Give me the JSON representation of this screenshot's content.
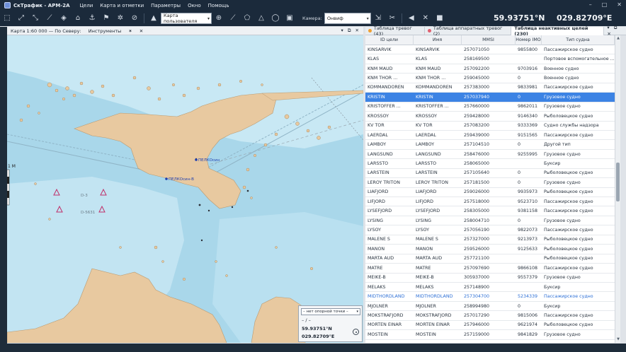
{
  "app": {
    "title": "СкТрафик - АРМ-2А",
    "menu": [
      "Цели",
      "Карта и отметки",
      "Параметры",
      "Окно",
      "Помощь"
    ]
  },
  "toolbar": {
    "map_combo": "Карта пользователя",
    "camera_label": "Камера:",
    "camera_combo": "Онвиф",
    "lat": "59.93751°N",
    "lon": "029.82709°E"
  },
  "left_panel": {
    "tab": "Карта 1:60 000 — По Северу:",
    "tab2": "Инструменты",
    "controls": "▾ ⧉ ✕"
  },
  "map": {
    "scale": "1 M",
    "labels": [
      "ПЕЛКОсин",
      "ПЕЛКОсин-В"
    ],
    "depths": [
      "D-3",
      "D-5631"
    ]
  },
  "coordbox": {
    "select": "– нет опорной точки –",
    "dash": "– / –",
    "lat": "59.93751°N",
    "lon": "029.82709°E"
  },
  "right_tabs": [
    {
      "label": "Таблица тревог (43)",
      "dot": "#f0a030",
      "active": false
    },
    {
      "label": "Таблица аппаратных тревог (2)",
      "dot": "#e06070",
      "active": false
    },
    {
      "label": "Таблица неактивных целей (230)",
      "dot": "",
      "active": true
    }
  ],
  "table": {
    "headers": [
      "ID цели",
      "Имя",
      "MMSI",
      "Номер IMO",
      "Тип судна"
    ],
    "rows": [
      {
        "id": "KINSARVIK",
        "name": "KINSARVIK",
        "mmsi": "257071050",
        "imo": "9855800",
        "type": "Пассажирское судно",
        "state": ""
      },
      {
        "id": "KLAS",
        "name": "KLAS",
        "mmsi": "258169500",
        "imo": "",
        "type": "Портовое вспомогательное ...",
        "state": ""
      },
      {
        "id": "KNM MAUD",
        "name": "KNM MAUD",
        "mmsi": "257092200",
        "imo": "9703916",
        "type": "Военное судно",
        "state": ""
      },
      {
        "id": "KNM THOR ...",
        "name": "KNM THOR ...",
        "mmsi": "259045000",
        "imo": "0",
        "type": "Военное судно",
        "state": ""
      },
      {
        "id": "KOMMANDOREN",
        "name": "KOMMANDOREN",
        "mmsi": "257383000",
        "imo": "9833981",
        "type": "Пассажирское судно",
        "state": ""
      },
      {
        "id": "KRISTIN",
        "name": "KRISTIN",
        "mmsi": "257037940",
        "imo": "0",
        "type": "Грузовое судно",
        "state": "selected"
      },
      {
        "id": "KRISTOFFER ...",
        "name": "KRISTOFFER ...",
        "mmsi": "257660000",
        "imo": "9862011",
        "type": "Грузовое судно",
        "state": ""
      },
      {
        "id": "KROSSOY",
        "name": "KROSSOY",
        "mmsi": "259428000",
        "imo": "9146340",
        "type": "Рыболовецкое судно",
        "state": ""
      },
      {
        "id": "KV TOR",
        "name": "KV TOR",
        "mmsi": "257083200",
        "imo": "9333369",
        "type": "Судно службы надзора",
        "state": ""
      },
      {
        "id": "LAERDAL",
        "name": "LAERDAL",
        "mmsi": "259439000",
        "imo": "9151565",
        "type": "Пассажирское судно",
        "state": ""
      },
      {
        "id": "LAMBOY",
        "name": "LAMBOY",
        "mmsi": "257104510",
        "imo": "0",
        "type": "Другой тип",
        "state": ""
      },
      {
        "id": "LANGSUND",
        "name": "LANGSUND",
        "mmsi": "258476000",
        "imo": "9255995",
        "type": "Грузовое судно",
        "state": ""
      },
      {
        "id": "LARSSTO",
        "name": "LARSSTO",
        "mmsi": "258065000",
        "imo": "",
        "type": "Буксир",
        "state": ""
      },
      {
        "id": "LARSTEIN",
        "name": "LARSTEIN",
        "mmsi": "257105640",
        "imo": "0",
        "type": "Рыболовецкое судно",
        "state": ""
      },
      {
        "id": "LEROY TRITON",
        "name": "LEROY TRITON",
        "mmsi": "257181500",
        "imo": "0",
        "type": "Грузовое судно",
        "state": ""
      },
      {
        "id": "LIAFJORD",
        "name": "LIAFJORD",
        "mmsi": "259026000",
        "imo": "9935973",
        "type": "Рыболовецкое судно",
        "state": ""
      },
      {
        "id": "LIFJORD",
        "name": "LIFJORD",
        "mmsi": "257518000",
        "imo": "9523710",
        "type": "Пассажирское судно",
        "state": ""
      },
      {
        "id": "LYSEFJORD",
        "name": "LYSEFJORD",
        "mmsi": "258305000",
        "imo": "9381158",
        "type": "Пассажирское судно",
        "state": ""
      },
      {
        "id": "LYSING",
        "name": "LYSING",
        "mmsi": "258004710",
        "imo": "0",
        "type": "Грузовое судно",
        "state": ""
      },
      {
        "id": "LYSOY",
        "name": "LYSOY",
        "mmsi": "257056190",
        "imo": "9822073",
        "type": "Пассажирское судно",
        "state": ""
      },
      {
        "id": "MALENE S",
        "name": "MALENE S",
        "mmsi": "257327000",
        "imo": "9213973",
        "type": "Рыболовецкое судно",
        "state": ""
      },
      {
        "id": "MANON",
        "name": "MANON",
        "mmsi": "259526000",
        "imo": "9125633",
        "type": "Рыболовецкое судно",
        "state": ""
      },
      {
        "id": "MARTA AUD",
        "name": "MARTA AUD",
        "mmsi": "257721100",
        "imo": "",
        "type": "Рыболовецкое судно",
        "state": ""
      },
      {
        "id": "MATRE",
        "name": "MATRE",
        "mmsi": "257097690",
        "imo": "9866108",
        "type": "Пассажирское судно",
        "state": ""
      },
      {
        "id": "MEIKE-B",
        "name": "MEIKE-B",
        "mmsi": "305937000",
        "imo": "9557379",
        "type": "Грузовое судно",
        "state": ""
      },
      {
        "id": "MELAKS",
        "name": "MELAKS",
        "mmsi": "257148900",
        "imo": "",
        "type": "Буксир",
        "state": ""
      },
      {
        "id": "MIDTHORDLAND",
        "name": "MIDTHORDLAND",
        "mmsi": "257304700",
        "imo": "5234339",
        "type": "Пассажирское судно",
        "state": "blue"
      },
      {
        "id": "MJOLNER",
        "name": "MJOLNER",
        "mmsi": "258994980",
        "imo": "0",
        "type": "Буксир",
        "state": ""
      },
      {
        "id": "MOKSTRAFJORD",
        "name": "MOKSTRAFJORD",
        "mmsi": "257017290",
        "imo": "9815006",
        "type": "Пассажирское судно",
        "state": ""
      },
      {
        "id": "MORTEN EINAR",
        "name": "MORTEN EINAR",
        "mmsi": "257946000",
        "imo": "9621974",
        "type": "Рыболовецкое судно",
        "state": ""
      },
      {
        "id": "MOSTEIN",
        "name": "MOSTEIN",
        "mmsi": "257159000",
        "imo": "9841829",
        "type": "Грузовое судно",
        "state": ""
      }
    ]
  },
  "colors": {
    "chrome": "#1b2a3b",
    "sea_deep": "#a9d7ea",
    "sea_shallow": "#c8e8f4",
    "land": "#e8c9a0",
    "selected_row": "#3c83e4",
    "label_blue": "#2c6fd6"
  }
}
